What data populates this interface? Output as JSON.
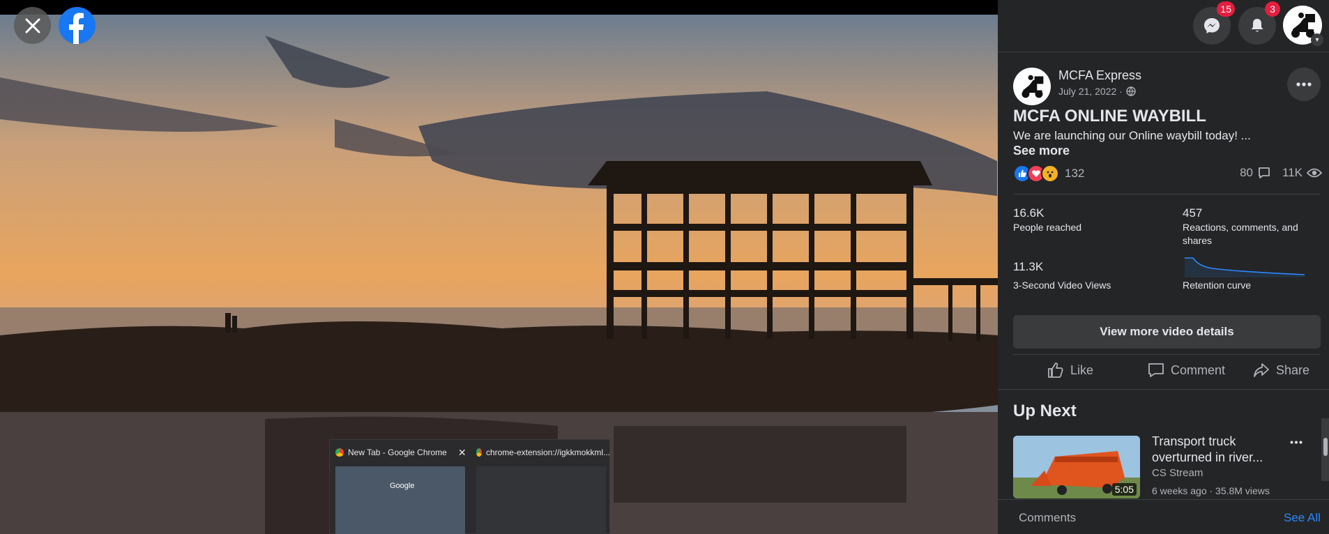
{
  "viewer": {
    "close_icon": "close-icon",
    "logo_icon": "facebook-logo-icon",
    "taskbar_preview": {
      "tab1_title": "New Tab - Google Chrome",
      "tab2_title": "chrome-extension://igkkmokkml...",
      "thumb_text": "Google"
    }
  },
  "topbar": {
    "messenger_badge": "15",
    "notifications_badge": "3"
  },
  "post": {
    "page_name": "MCFA Express",
    "date": "July 21, 2022 ·",
    "title": "MCFA ONLINE WAYBILL",
    "description": "We are launching our Online waybill today! ...",
    "see_more": "See more",
    "reaction_count": "132",
    "comment_count": "80",
    "view_count": "11K"
  },
  "stats": {
    "reached_value": "16.6K",
    "reached_label": "People reached",
    "engagement_value": "457",
    "engagement_label": "Reactions, comments, and shares",
    "views_value": "11.3K",
    "views_label": "3-Second Video Views",
    "retention_label": "Retention curve",
    "view_details": "View more video details"
  },
  "actions": {
    "like": "Like",
    "comment": "Comment",
    "share": "Share"
  },
  "up_next": {
    "heading": "Up Next",
    "title": "Transport truck overturned in river...",
    "channel": "CS Stream",
    "meta": "6 weeks ago · 35.8M views",
    "duration": "5:05"
  },
  "comments": {
    "label": "Comments",
    "see_all": "See All"
  },
  "colors": {
    "panel_bg": "#242526",
    "accent_link": "#2d88ff",
    "badge": "#e41e3f",
    "fb_blue": "#1877f2"
  }
}
